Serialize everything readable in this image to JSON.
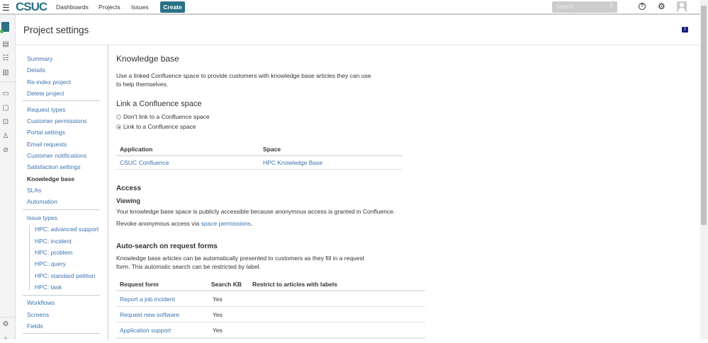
{
  "topbar": {
    "logo": "CSUC",
    "nav": [
      "Dashboards",
      "Projects",
      "Issues"
    ],
    "create": "Create",
    "search_placeholder": "Search"
  },
  "page_title": "Project settings",
  "sidebar": {
    "groups": [
      [
        "Summary",
        "Details",
        "Re-index project",
        "Delete project"
      ],
      [
        "Request types",
        "Customer permissions",
        "Portal settings",
        "Email requests",
        "Customer notifications",
        "Satisfaction settings",
        "Knowledge base",
        "SLAs",
        "Automation"
      ],
      [
        "Issue types"
      ],
      [
        "Workflows",
        "Screens",
        "Fields"
      ]
    ],
    "issue_types": [
      "HPC: advanced support",
      "HPC: incident",
      "HPC: problem",
      "HPC: query",
      "HPC: standard petition",
      "HPC: task"
    ],
    "active": "Knowledge base"
  },
  "main": {
    "title": "Knowledge base",
    "intro": "Use a linked Confluence space to provide customers with knowledge base articles they can use to help themselves.",
    "link_heading": "Link a Confluence space",
    "radio_options": [
      "Don't link to a Confluence space",
      "Link to a Confluence space"
    ],
    "radio_selected": "Link to a Confluence space",
    "link_table": {
      "headers": [
        "Application",
        "Space"
      ],
      "rows": [
        [
          "CSUC Confluence",
          "HPC Knowledge Base"
        ]
      ]
    },
    "access_heading": "Access",
    "viewing_heading": "Viewing",
    "viewing_text": "Your knowledge base space is publicly accessible because anonymous access is granted in Confluence.",
    "revoke_prefix": "Revoke anonymous access via ",
    "revoke_link": "space permissions",
    "revoke_suffix": ".",
    "autosearch_heading": "Auto-search on request forms",
    "autosearch_text": "Knowledge base articles can be automatically presented to customers as they fill in a request form. This automatic search can be restricted by label.",
    "forms_table": {
      "headers": [
        "Request form",
        "Search KB",
        "Restrict to articles with labels"
      ],
      "rows": [
        [
          "Report a job incident",
          "Yes",
          ""
        ],
        [
          "Request new software",
          "Yes",
          ""
        ],
        [
          "Application support",
          "Yes",
          ""
        ]
      ]
    }
  }
}
